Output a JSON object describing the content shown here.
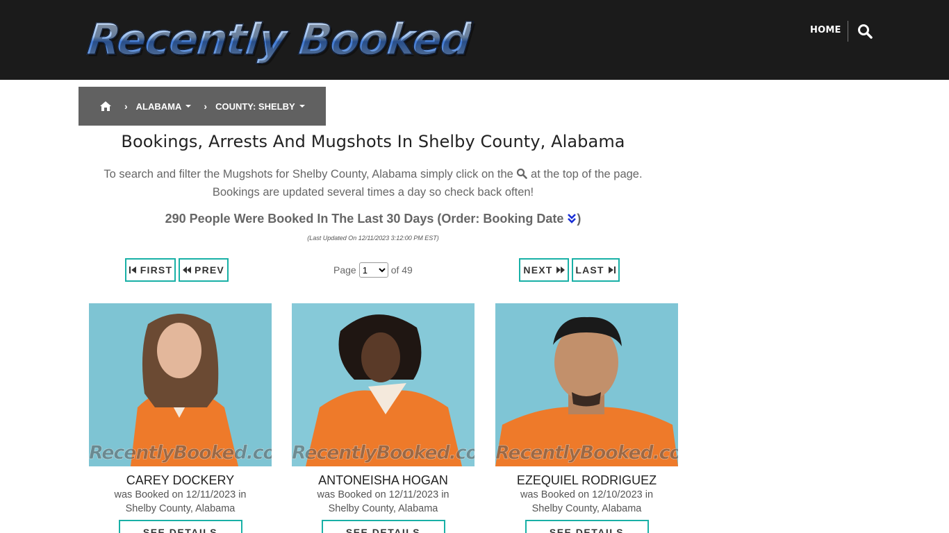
{
  "header": {
    "logo_text": "Recently Booked",
    "nav_home": "HOME",
    "search_icon": "search-icon"
  },
  "breadcrumb": {
    "home_icon": "home-icon",
    "items": [
      {
        "label": "ALABAMA"
      },
      {
        "label": "COUNTY: SHELBY"
      }
    ]
  },
  "page": {
    "title": "Bookings, Arrests And Mugshots In Shelby County, Alabama",
    "intro_part1": "To search and filter the Mugshots for Shelby County, Alabama simply click on the",
    "intro_part2": "at the top of the page.",
    "intro_line2": "Bookings are updated several times a day so check back often!",
    "count_text": "290 People Were Booked In The Last 30 Days (Order: Booking Date",
    "count_close": ")",
    "updated": "(Last Updated On 12/11/2023 3:12:00 PM EST)"
  },
  "pagination": {
    "first": "FIRST",
    "prev": "PREV",
    "next": "NEXT",
    "last": "LAST",
    "page_label": "Page",
    "current_page": "1",
    "of_label": "of 49"
  },
  "records": [
    {
      "name": "CAREY DOCKERY",
      "booked_line1": "was Booked on 12/11/2023 in",
      "booked_line2": "Shelby County, Alabama",
      "watermark": "RecentlyBooked.com",
      "button": "SEE DETAILS"
    },
    {
      "name": "ANTONEISHA HOGAN",
      "booked_line1": "was Booked on 12/11/2023 in",
      "booked_line2": "Shelby County, Alabama",
      "watermark": "RecentlyBooked.com",
      "button": "SEE DETAILS"
    },
    {
      "name": "EZEQUIEL RODRIGUEZ",
      "booked_line1": "was Booked on 12/10/2023 in",
      "booked_line2": "Shelby County, Alabama",
      "watermark": "RecentlyBooked.com",
      "button": "SEE DETAILS"
    }
  ],
  "colors": {
    "header_bg": "#1b1b1b",
    "breadcrumb_bg": "#616161",
    "accent": "#18b0a6",
    "sort_icon": "#1a2fd6"
  }
}
